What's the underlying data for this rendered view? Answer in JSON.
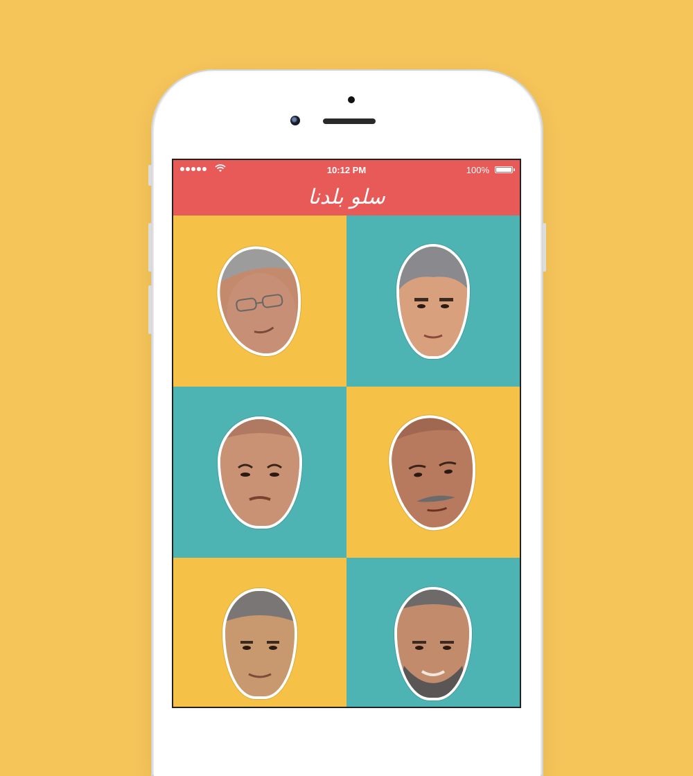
{
  "background_color": "#F5C55A",
  "status_bar": {
    "time": "10:12 PM",
    "battery": "100%",
    "signal_icon": "signal-dots-icon",
    "wifi_icon": "wifi-icon",
    "battery_icon": "battery-icon"
  },
  "nav": {
    "title": "سلو بلدنا",
    "color": "#E85A58"
  },
  "tile_colors": {
    "yellow": "#F5C146",
    "teal": "#4DB3B3"
  },
  "faces": [
    {
      "id": "face-1",
      "icon": "face-sticker-bald-glasses",
      "tile": "yellow"
    },
    {
      "id": "face-2",
      "icon": "face-sticker-gray-hair",
      "tile": "teal"
    },
    {
      "id": "face-3",
      "icon": "face-sticker-bald-round",
      "tile": "teal"
    },
    {
      "id": "face-4",
      "icon": "face-sticker-bald-mustache",
      "tile": "yellow"
    },
    {
      "id": "face-5",
      "icon": "face-sticker-short-hair",
      "tile": "yellow"
    },
    {
      "id": "face-6",
      "icon": "face-sticker-beard",
      "tile": "teal"
    }
  ]
}
